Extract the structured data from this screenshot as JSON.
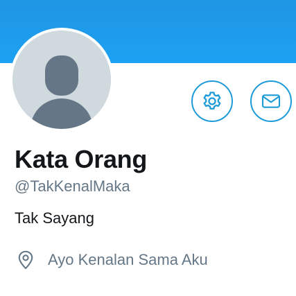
{
  "profile": {
    "display_name": "Kata Orang",
    "handle": "@TakKenalMaka",
    "bio": "Tak Sayang",
    "location": "Ayo Kenalan Sama Aku"
  },
  "actions": {
    "settings_icon": "gear-icon",
    "message_icon": "mail-icon"
  },
  "icons": {
    "location_icon": "map-pin-icon",
    "avatar": "default-user-avatar"
  },
  "colors": {
    "banner": "#1da1f2",
    "accent": "#1d9bd8",
    "avatar_bg": "#cfd9de",
    "avatar_fg": "#657786",
    "name_text": "#14171a",
    "secondary_text": "#657786"
  }
}
